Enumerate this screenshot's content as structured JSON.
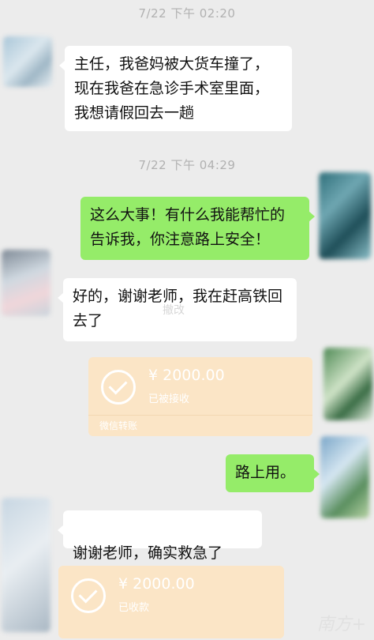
{
  "timestamps": [
    "7/22 下午 02:20",
    "7/22 下午 04:29"
  ],
  "messages": [
    {
      "text": "主任，我爸妈被大货车撞了，\n现在我爸在急诊手术室里面，\n我想请假回去一趟"
    },
    {
      "text": "这么大事！有什么我能帮忙的\n告诉我，你注意路上安全！"
    },
    {
      "text": "好的，谢谢老师，我在赶高铁回\n去了"
    },
    {
      "text": "路上用。"
    },
    {
      "text": "谢谢老师，确实救急了"
    }
  ],
  "transfers": [
    {
      "amount": "¥ 2000.00",
      "status": "已被接收",
      "footer": "微信转账"
    },
    {
      "amount": "¥ 2000.00",
      "status": "已收款"
    }
  ],
  "icons": {
    "transfer_status": "checkmark-circle-icon",
    "emoji": "folded-hands-emoji-icon"
  },
  "overlay": {
    "stamp": "撤改",
    "watermark": "南方+"
  },
  "colors": {
    "background": "#ececec",
    "incoming_bubble": "#ffffff",
    "outgoing_bubble": "#95ec69",
    "transfer_card": "#fbe5c6"
  }
}
